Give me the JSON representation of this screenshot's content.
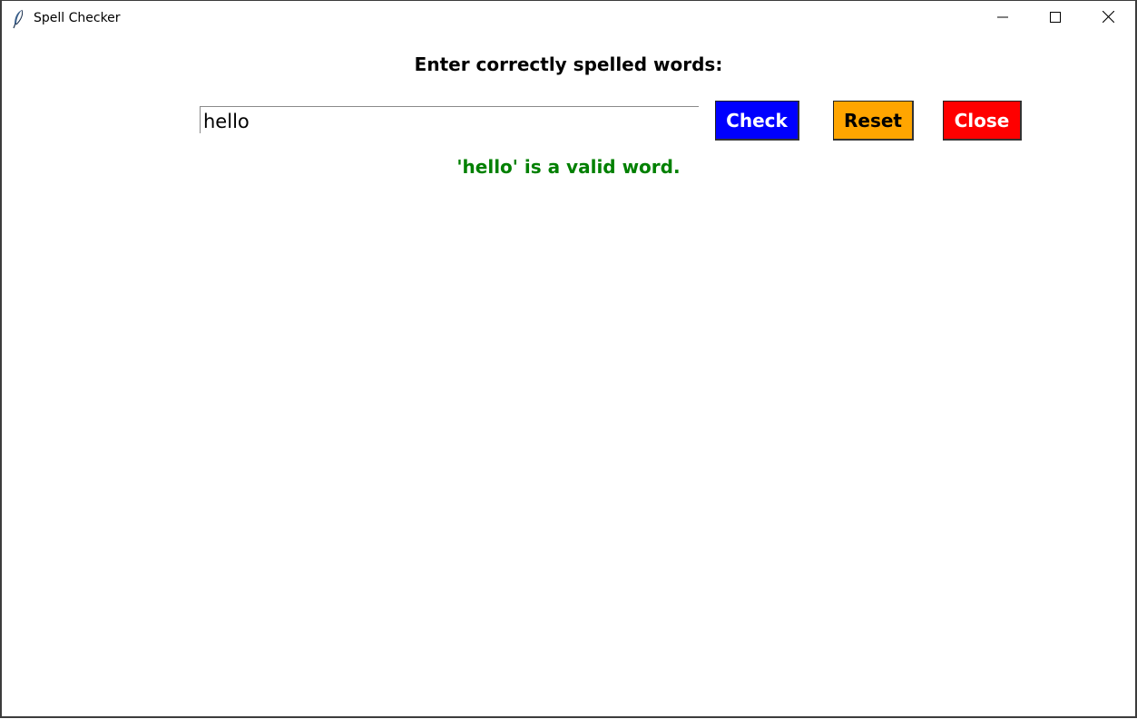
{
  "window": {
    "title": "Spell Checker",
    "icon": "feather-icon",
    "controls": [
      "minimize-icon",
      "maximize-icon",
      "close-icon"
    ]
  },
  "prompt": "Enter correctly spelled words:",
  "word_input": {
    "value": "hello",
    "placeholder": ""
  },
  "buttons": {
    "check": {
      "label": "Check",
      "bg": "#0000ff",
      "fg": "#ffffff"
    },
    "reset": {
      "label": "Reset",
      "bg": "#ffa500",
      "fg": "#000000"
    },
    "close": {
      "label": "Close",
      "bg": "#ff0000",
      "fg": "#ffffff"
    }
  },
  "result": {
    "text": "'hello' is a valid word.",
    "color": "#008000"
  }
}
